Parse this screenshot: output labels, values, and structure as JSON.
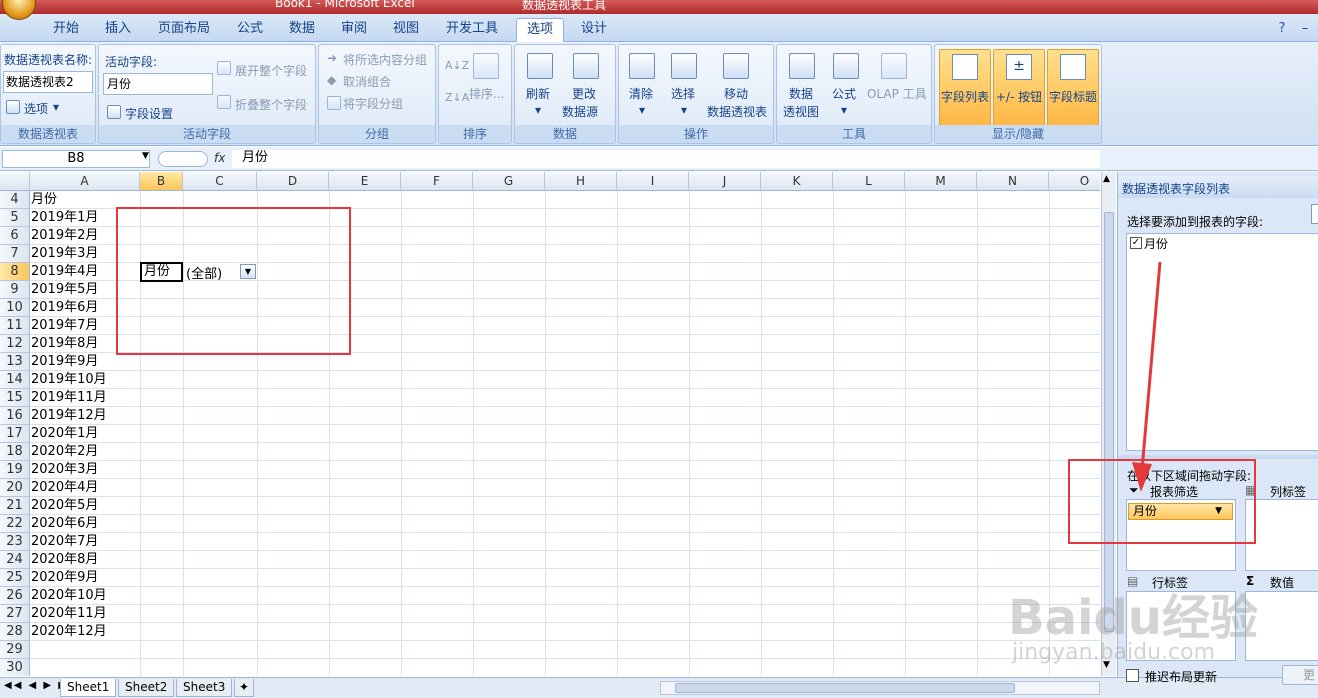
{
  "window": {
    "doc_title": "Book1 - Microsoft Excel",
    "context_title": "数据透视表工具"
  },
  "ribbon_tabs": [
    "开始",
    "插入",
    "页面布局",
    "公式",
    "数据",
    "审阅",
    "视图",
    "开发工具",
    "选项",
    "设计"
  ],
  "active_tab": "选项",
  "ribbon": {
    "pivot_group": {
      "name_label": "数据透视表名称:",
      "name_value": "数据透视表2",
      "options_btn": "选项",
      "group_label": "数据透视表"
    },
    "field_group": {
      "active_field_label": "活动字段:",
      "active_field_value": "月份",
      "field_settings": "字段设置",
      "expand": "展开整个字段",
      "collapse": "折叠整个字段",
      "group_label": "活动字段"
    },
    "grouping": {
      "group_selection": "将所选内容分组",
      "ungroup": "取消组合",
      "group_field": "将字段分组",
      "group_label": "分组"
    },
    "sort": {
      "sort_btn": "排序...",
      "group_label": "排序"
    },
    "data": {
      "refresh": "刷新",
      "change_source_1": "更改",
      "change_source_2": "数据源",
      "group_label": "数据"
    },
    "actions": {
      "clear": "清除",
      "select": "选择",
      "move_1": "移动",
      "move_2": "数据透视表",
      "group_label": "操作"
    },
    "tools": {
      "pivotchart_1": "数据",
      "pivotchart_2": "透视图",
      "formulas": "公式",
      "olap": "OLAP 工具",
      "group_label": "工具"
    },
    "show_hide": {
      "field_list": "字段列表",
      "buttons": "+/- 按钮",
      "headers": "字段标题",
      "group_label": "显示/隐藏"
    }
  },
  "formula_bar": {
    "name_box": "B8",
    "fx": "fx",
    "value": "月份"
  },
  "columns": [
    "A",
    "B",
    "C",
    "D",
    "E",
    "F",
    "G",
    "H",
    "I",
    "J",
    "K",
    "L",
    "M",
    "N",
    "O"
  ],
  "rows": [
    {
      "num": "4",
      "a": "月份"
    },
    {
      "num": "5",
      "a": "2019年1月"
    },
    {
      "num": "6",
      "a": "2019年2月"
    },
    {
      "num": "7",
      "a": "2019年3月"
    },
    {
      "num": "8",
      "a": "2019年4月"
    },
    {
      "num": "9",
      "a": "2019年5月"
    },
    {
      "num": "10",
      "a": "2019年6月"
    },
    {
      "num": "11",
      "a": "2019年7月"
    },
    {
      "num": "12",
      "a": "2019年8月"
    },
    {
      "num": "13",
      "a": "2019年9月"
    },
    {
      "num": "14",
      "a": "2019年10月"
    },
    {
      "num": "15",
      "a": "2019年11月"
    },
    {
      "num": "16",
      "a": "2019年12月"
    },
    {
      "num": "17",
      "a": "2020年1月"
    },
    {
      "num": "18",
      "a": "2020年2月"
    },
    {
      "num": "19",
      "a": "2020年3月"
    },
    {
      "num": "20",
      "a": "2020年4月"
    },
    {
      "num": "21",
      "a": "2020年5月"
    },
    {
      "num": "22",
      "a": "2020年6月"
    },
    {
      "num": "23",
      "a": "2020年7月"
    },
    {
      "num": "24",
      "a": "2020年8月"
    },
    {
      "num": "25",
      "a": "2020年9月"
    },
    {
      "num": "26",
      "a": "2020年10月"
    },
    {
      "num": "27",
      "a": "2020年11月"
    },
    {
      "num": "28",
      "a": "2020年12月"
    },
    {
      "num": "29",
      "a": ""
    },
    {
      "num": "30",
      "a": ""
    }
  ],
  "pivot_filter": {
    "field": "月份",
    "value": "(全部)"
  },
  "sheet_tabs": [
    "Sheet1",
    "Sheet2",
    "Sheet3"
  ],
  "field_panel": {
    "title": "数据透视表字段列表",
    "choose_label": "选择要添加到报表的字段:",
    "field_item": "月份",
    "drag_label": "在以下区域间拖动字段:",
    "report_filter": "报表筛选",
    "column_labels": "列标签",
    "row_labels": "行标签",
    "values": "数值",
    "filter_pill": "月份",
    "defer_update": "推迟布局更新",
    "update_btn": "更"
  },
  "watermark": {
    "brand": "Baidu经验",
    "url": "jingyan.baidu.com"
  }
}
